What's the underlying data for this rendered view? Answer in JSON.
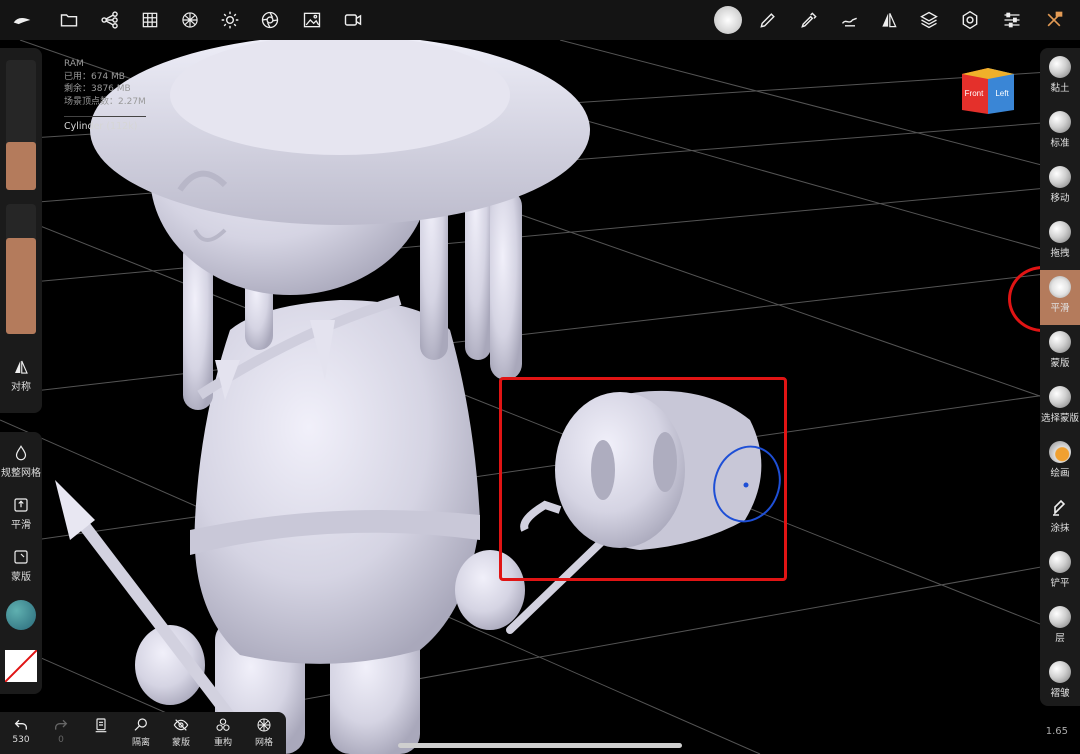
{
  "app": {
    "name": "Nomad Sculpt"
  },
  "topbar": {
    "icons": [
      "logo-icon",
      "folder-icon",
      "scene-tree-icon",
      "grid-icon",
      "material-sphere-icon",
      "light-icon",
      "render-icon",
      "background-image-icon",
      "camera-icon",
      "brush-stroke-icon",
      "pen-icon",
      "eyedropper-icon",
      "smooth-tool-icon",
      "symmetry-icon",
      "layers-icon",
      "settings-icon",
      "sliders-icon",
      "close-tools-icon"
    ]
  },
  "stats": {
    "ram_label": "RAM",
    "used": "已用：674 MB",
    "free": "剩余：3876 MB",
    "verts": "场景顶点数：2.27M",
    "object": "Cylinder (112k)"
  },
  "left_panel": {
    "symmetry_label": "对称",
    "remesh_label": "规整网格",
    "smooth_label": "平滑",
    "mask_label": "蒙版"
  },
  "right_tools": [
    {
      "label": "黏土"
    },
    {
      "label": "标准"
    },
    {
      "label": "移动"
    },
    {
      "label": "拖拽"
    },
    {
      "label": "平滑"
    },
    {
      "label": "蒙版"
    },
    {
      "label": "选择蒙版"
    },
    {
      "label": "绘画"
    },
    {
      "label": "涂抹"
    },
    {
      "label": "铲平"
    },
    {
      "label": "层"
    },
    {
      "label": "褶皱"
    }
  ],
  "version": "1.65",
  "bottombar": {
    "undo_count": "530",
    "redo_count": "0",
    "hide_label": "隔离",
    "mask_label": "蒙版",
    "remesh_label": "重构",
    "mesh_label": "网格"
  },
  "cube": {
    "front": "Front",
    "left": "Left"
  },
  "colors": {
    "accent": "#b47b5c",
    "annotation": "#e01414",
    "brush_cursor": "#1e4fd6",
    "sculpt": "#d9d8e6"
  }
}
